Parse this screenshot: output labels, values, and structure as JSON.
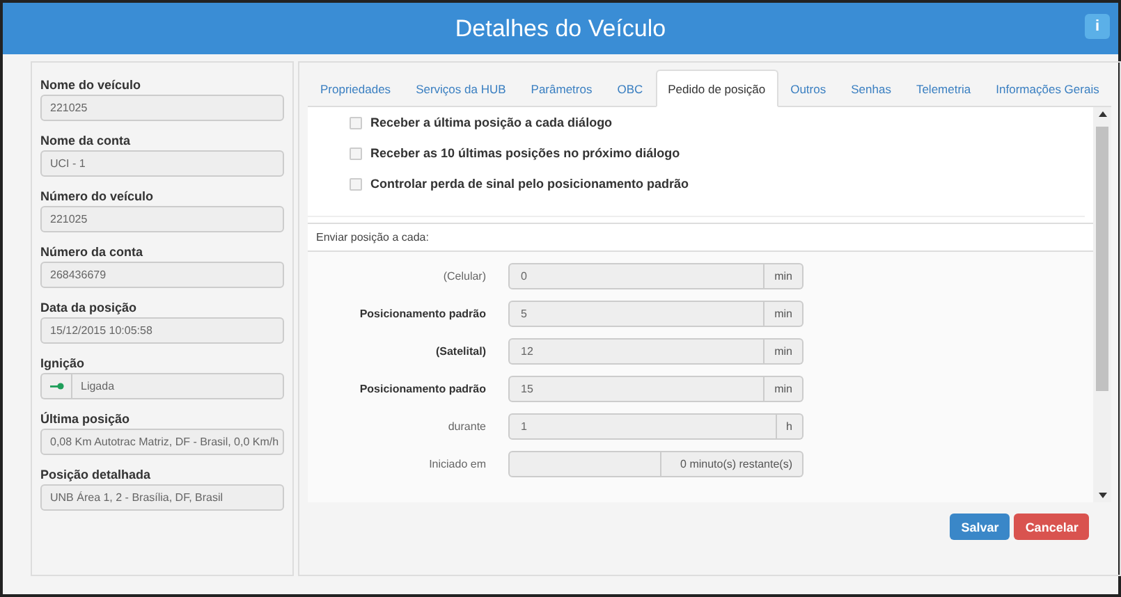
{
  "window": {
    "title": "Detalhes do Veículo",
    "info_button": "i"
  },
  "vehicle": [
    {
      "kind": "plain",
      "label": "Nome do veículo",
      "value": "221025"
    },
    {
      "kind": "plain",
      "label": "Nome da conta",
      "value": "UCI - 1"
    },
    {
      "kind": "plain",
      "label": "Número do veículo",
      "value": "221025"
    },
    {
      "kind": "plain",
      "label": "Número da conta",
      "value": "268436679"
    },
    {
      "kind": "plain",
      "label": "Data da posição",
      "value": "15/12/2015 10:05:58"
    },
    {
      "kind": "ignition",
      "label": "Ignição",
      "value": "Ligada"
    },
    {
      "kind": "plain",
      "label": "Última posição",
      "value": "0,08 Km Autotrac Matriz, DF - Brasil, 0,0 Km/h"
    },
    {
      "kind": "plain",
      "label": "Posição detalhada",
      "value": "UNB Área 1, 2 - Brasília, DF, Brasil"
    }
  ],
  "tabs": [
    {
      "label": "Propriedades",
      "selected": false
    },
    {
      "label": "Serviços da HUB",
      "selected": false
    },
    {
      "label": "Parâmetros",
      "selected": false
    },
    {
      "label": "OBC",
      "selected": false
    },
    {
      "label": "Pedido de posição",
      "selected": true
    },
    {
      "label": "Outros",
      "selected": false
    },
    {
      "label": "Senhas",
      "selected": false
    },
    {
      "label": "Telemetria",
      "selected": false
    },
    {
      "label": "Informações Gerais",
      "selected": false
    }
  ],
  "options": [
    {
      "label": "Receber a última posição a cada diálogo",
      "checked": false
    },
    {
      "label": "Receber as 10 últimas posições no próximo diálogo",
      "checked": false
    },
    {
      "label": "Controlar perda de sinal pelo posicionamento padrão",
      "checked": false
    }
  ],
  "section_title": "Enviar posição a cada:",
  "intervals": [
    {
      "kind": "unit",
      "label": "(Celular)",
      "bold": false,
      "value": "0",
      "unit": "min"
    },
    {
      "kind": "unit",
      "label": "Posicionamento padrão",
      "bold": true,
      "value": "5",
      "unit": "min"
    },
    {
      "kind": "unit",
      "label": "(Satelital)",
      "bold": true,
      "value": "12",
      "unit": "min"
    },
    {
      "kind": "unit",
      "label": "Posicionamento padrão",
      "bold": true,
      "value": "15",
      "unit": "min"
    },
    {
      "kind": "unit",
      "label": "durante",
      "bold": false,
      "value": "1",
      "unit": "h"
    },
    {
      "kind": "remaining",
      "label": "Iniciado em",
      "bold": false,
      "unit": "0 minuto(s) restante(s)"
    }
  ],
  "buttons": [
    {
      "kind": "primary",
      "label": "Salvar"
    },
    {
      "kind": "danger",
      "label": "Cancelar"
    }
  ]
}
